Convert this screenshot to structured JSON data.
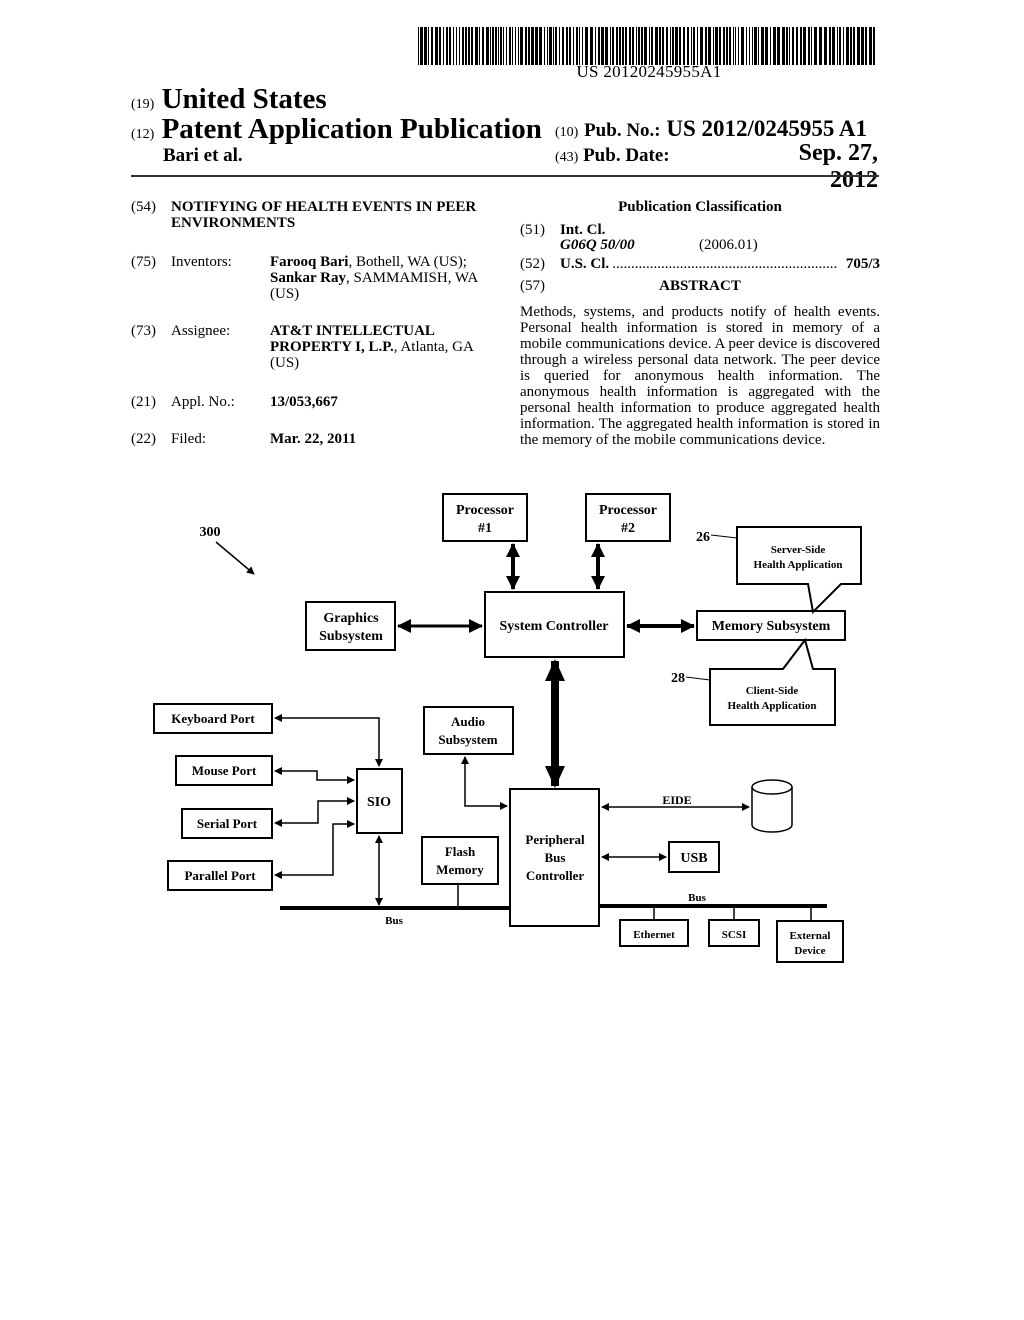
{
  "header": {
    "barcode_number": "US 20120245955A1",
    "country_code": "(19)",
    "country": "United States",
    "type_code": "(12)",
    "type": "Patent Application Publication",
    "applicant": "Bari et al.",
    "pub_no_code": "(10)",
    "pub_no_label": "Pub. No.:",
    "pub_no": "US 2012/0245955 A1",
    "pub_date_code": "(43)",
    "pub_date_label": "Pub. Date:",
    "pub_date": "Sep. 27, 2012"
  },
  "biblio": {
    "title_code": "(54)",
    "title_line1": "NOTIFYING OF HEALTH EVENTS IN PEER",
    "title_line2": "ENVIRONMENTS",
    "inventors_code": "(75)",
    "inventors_label": "Inventors:",
    "inventor1_name": "Farooq Bari",
    "inventor1_loc": ", Bothell, WA (US);",
    "inventor2_name": "Sankar Ray",
    "inventor2_loc": ", SAMMAMISH, WA",
    "inventor2_loc2": "(US)",
    "assignee_code": "(73)",
    "assignee_label": "Assignee:",
    "assignee_line1": "AT&T INTELLECTUAL",
    "assignee_name2": "PROPERTY I, L.P.",
    "assignee_loc": ", Atlanta, GA",
    "assignee_loc2": "(US)",
    "appl_code": "(21)",
    "appl_label": "Appl. No.:",
    "appl_no": "13/053,667",
    "filed_code": "(22)",
    "filed_label": "Filed:",
    "filed_date": "Mar. 22, 2011"
  },
  "classification": {
    "heading": "Publication Classification",
    "int_code": "(51)",
    "int_label": "Int. Cl.",
    "int_class": "G06Q 50/00",
    "int_year": "(2006.01)",
    "us_code": "(52)",
    "us_label": "U.S. Cl.",
    "us_dots": "............................................................",
    "us_class": "705/3",
    "abstract_code": "(57)",
    "abstract_heading": "ABSTRACT"
  },
  "abstract": "Methods, systems, and products notify of health events. Personal health information is stored in memory of a mobile communications device. A peer device is discovered through a wireless personal data network. The peer device is queried for anonymous health information. The anonymous health information is aggregated with the personal health information to produce aggregated health information. The aggregated health information is stored in the memory of the mobile communications device.",
  "figure": {
    "ref_number": "300",
    "ref_26": "26",
    "ref_28": "28",
    "processor1": [
      "Processor",
      "#1"
    ],
    "processor2": [
      "Processor",
      "#2"
    ],
    "graphics": [
      "Graphics",
      "Subsystem"
    ],
    "system_controller": "System Controller",
    "memory_subsystem": "Memory Subsystem",
    "server_app": [
      "Server-Side",
      "Health Application"
    ],
    "client_app": [
      "Client-Side",
      "Health Application"
    ],
    "keyboard_port": "Keyboard Port",
    "mouse_port": "Mouse Port",
    "serial_port": "Serial Port",
    "parallel_port": "Parallel Port",
    "sio": "SIO",
    "audio": [
      "Audio",
      "Subsystem"
    ],
    "flash": [
      "Flash",
      "Memory"
    ],
    "peripheral": [
      "Peripheral",
      "Bus",
      "Controller"
    ],
    "eide": "EIDE",
    "usb": "USB",
    "bus_left": "Bus",
    "bus_right": "Bus",
    "ethernet": "Ethernet",
    "scsi": "SCSI",
    "external": [
      "External",
      "Device"
    ]
  }
}
